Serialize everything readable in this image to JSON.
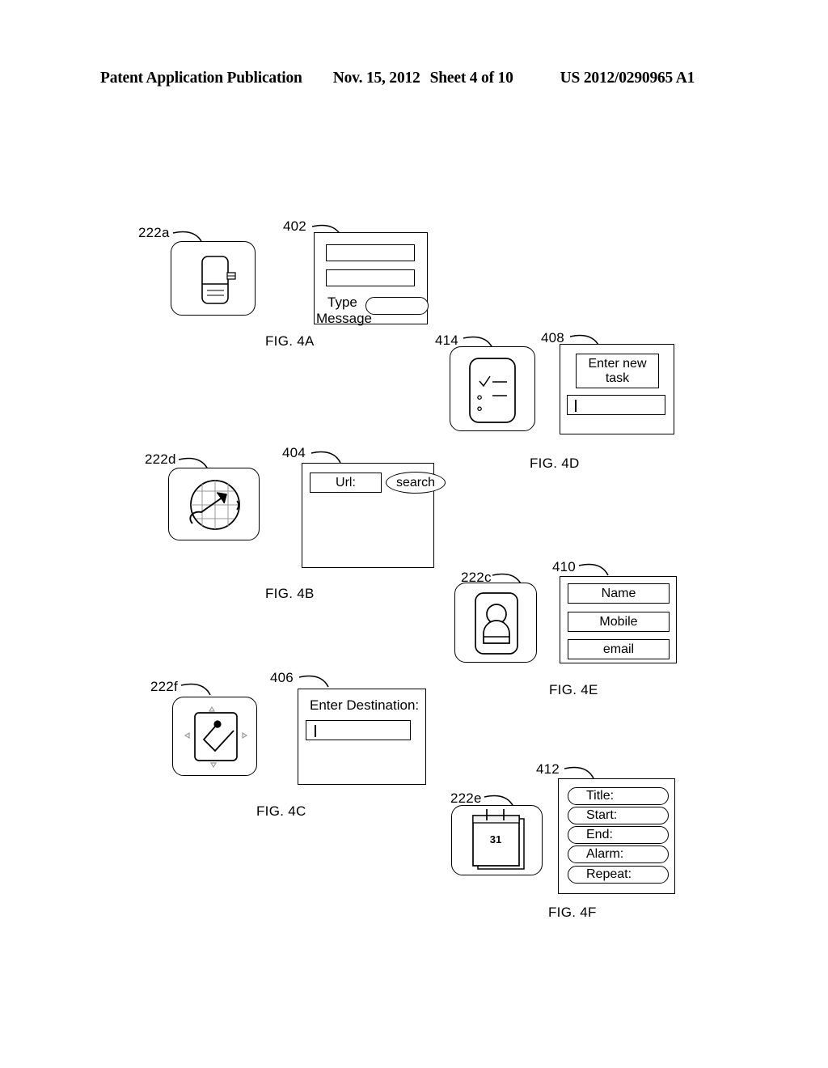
{
  "header": {
    "publication": "Patent Application Publication",
    "date": "Nov. 15, 2012",
    "sheet": "Sheet 4 of 10",
    "patent_number": "US 2012/0290965 A1"
  },
  "figures": [
    {
      "caption": "FIG. 4A",
      "icon_ref": "222a",
      "icon_name": "messaging-icon",
      "screen_ref": "402",
      "screen_name": "messaging-screen",
      "screen_texts": [
        "Type",
        "Message"
      ]
    },
    {
      "caption": "FIG. 4B",
      "icon_ref": "222d",
      "icon_name": "browser-globe-icon",
      "screen_ref": "404",
      "screen_name": "browser-screen",
      "url_label": "Url:",
      "search_label": "search"
    },
    {
      "caption": "FIG. 4C",
      "icon_ref": "222f",
      "icon_name": "navigation-icon",
      "screen_ref": "406",
      "screen_name": "navigation-screen",
      "prompt": "Enter Destination:"
    },
    {
      "caption": "FIG. 4D",
      "icon_ref": "414",
      "icon_name": "tasks-checklist-icon",
      "screen_ref": "408",
      "screen_name": "task-entry-screen",
      "prompt_line1": "Enter new",
      "prompt_line2": "task"
    },
    {
      "caption": "FIG. 4E",
      "icon_ref": "222c",
      "icon_name": "contacts-icon",
      "screen_ref": "410",
      "screen_name": "contact-entry-screen",
      "fields": [
        "Name",
        "Mobile",
        "email"
      ]
    },
    {
      "caption": "FIG. 4F",
      "icon_ref": "222e",
      "icon_name": "calendar-icon",
      "calendar_day": "31",
      "screen_ref": "412",
      "screen_name": "event-entry-screen",
      "fields": [
        "Title:",
        "Start:",
        "End:",
        "Alarm:",
        "Repeat:"
      ]
    }
  ]
}
